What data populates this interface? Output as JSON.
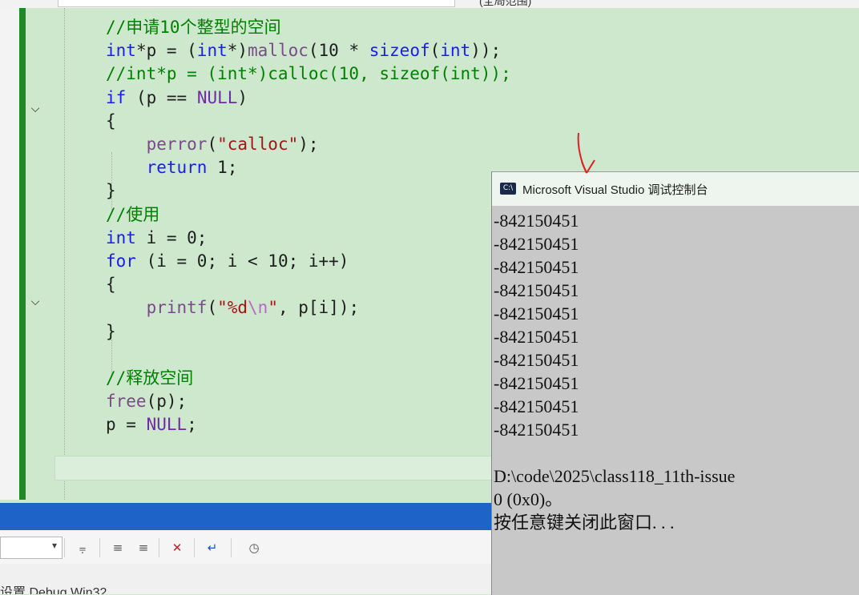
{
  "top_right_text": "(全局范围)",
  "code_lines": [
    {
      "n": "c1",
      "parts": [
        [
          "cm",
          "//申请10个整型的空间"
        ]
      ]
    },
    {
      "n": "c2",
      "parts": [
        [
          "kw",
          "int"
        ],
        [
          "",
          "*p = ("
        ],
        [
          "kw",
          "int"
        ],
        [
          "",
          "*)"
        ],
        [
          "fn",
          "malloc"
        ],
        [
          "",
          "(10 * "
        ],
        [
          "kw",
          "sizeof"
        ],
        [
          "",
          "("
        ],
        [
          "kw",
          "int"
        ],
        [
          "",
          "));"
        ]
      ]
    },
    {
      "n": "c3",
      "parts": [
        [
          "cm",
          "//int*p = (int*)calloc(10, sizeof(int));"
        ]
      ]
    },
    {
      "n": "c4",
      "parts": [
        [
          "kw",
          "if"
        ],
        [
          "",
          " (p == "
        ],
        [
          "mac",
          "NULL"
        ],
        [
          "",
          ")"
        ]
      ]
    },
    {
      "n": "c5",
      "parts": [
        [
          "",
          "{"
        ]
      ]
    },
    {
      "n": "c6",
      "parts": [
        [
          "",
          "    "
        ],
        [
          "fn",
          "perror"
        ],
        [
          "",
          "("
        ],
        [
          "str",
          "\"calloc\""
        ],
        [
          "",
          ");"
        ]
      ]
    },
    {
      "n": "c7",
      "parts": [
        [
          "",
          "    "
        ],
        [
          "kw",
          "return"
        ],
        [
          "",
          " 1;"
        ]
      ]
    },
    {
      "n": "c8",
      "parts": [
        [
          "",
          "}"
        ]
      ]
    },
    {
      "n": "c9",
      "parts": [
        [
          "cm",
          "//使用"
        ]
      ]
    },
    {
      "n": "c10",
      "parts": [
        [
          "kw",
          "int"
        ],
        [
          "",
          " i = 0;"
        ]
      ]
    },
    {
      "n": "c11",
      "parts": [
        [
          "kw",
          "for"
        ],
        [
          "",
          " (i = 0; i < 10; i++)"
        ]
      ]
    },
    {
      "n": "c12",
      "parts": [
        [
          "",
          "{"
        ]
      ]
    },
    {
      "n": "c13",
      "parts": [
        [
          "",
          "    "
        ],
        [
          "fn",
          "printf"
        ],
        [
          "",
          "("
        ],
        [
          "str",
          "\"%d"
        ],
        [
          "esc",
          "\\n"
        ],
        [
          "str",
          "\""
        ],
        [
          "",
          ", p[i]);"
        ]
      ]
    },
    {
      "n": "c14",
      "parts": [
        [
          "",
          "}"
        ]
      ]
    },
    {
      "n": "c15",
      "parts": [
        [
          "",
          ""
        ]
      ]
    },
    {
      "n": "c16",
      "parts": [
        [
          "cm",
          "//释放空间"
        ]
      ]
    },
    {
      "n": "c17",
      "parts": [
        [
          "fn",
          "free"
        ],
        [
          "",
          "(p);"
        ]
      ]
    },
    {
      "n": "c18",
      "parts": [
        [
          "",
          "p = "
        ],
        [
          "mac",
          "NULL"
        ],
        [
          "",
          ";"
        ]
      ]
    }
  ],
  "console": {
    "title": "Microsoft Visual Studio 调试控制台",
    "icon_text": "C:\\",
    "lines": [
      "-842150451",
      "-842150451",
      "-842150451",
      "-842150451",
      "-842150451",
      "-842150451",
      "-842150451",
      "-842150451",
      "-842150451",
      "-842150451",
      "",
      "D:\\code\\2025\\class118_11th-issue",
      "0 (0x0)。",
      "按任意键关闭此窗口. . ."
    ]
  },
  "bottom_text": "设置 Debug Win32",
  "toolbar_icons": [
    "dropdown-icon",
    "format-icon",
    "indent-icon",
    "outdent-icon",
    "comment-icon",
    "wrap-icon",
    "history-icon"
  ],
  "colors": {
    "editor_bg": "#cde8cd",
    "change_bar": "#1f8a24",
    "status_bar": "#1e64c8",
    "console_bg": "#c8c8c8"
  }
}
